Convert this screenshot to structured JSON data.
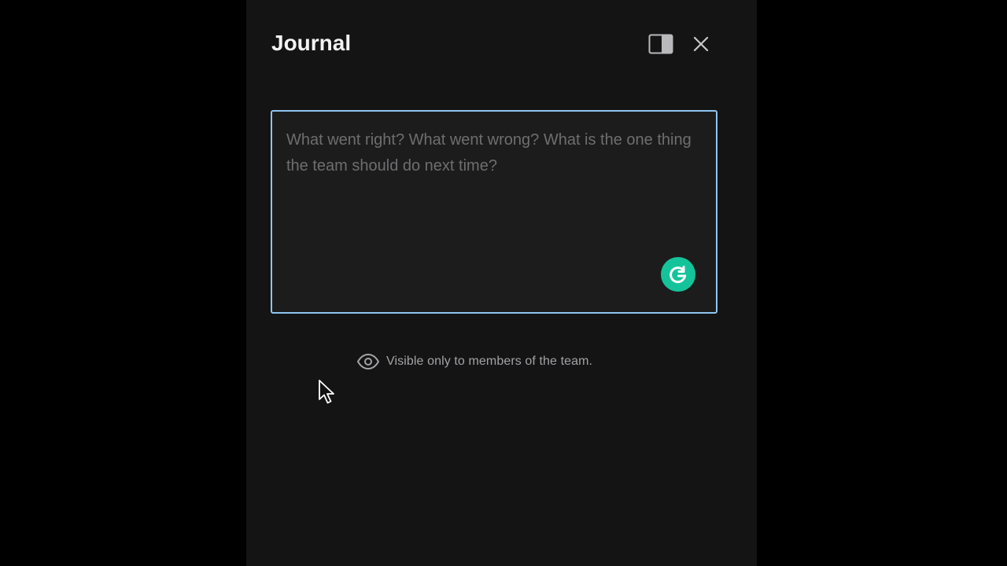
{
  "header": {
    "title": "Journal"
  },
  "icons": {
    "panel_toggle": "sidebar-panel-icon",
    "close": "close-icon",
    "grammarly": "grammarly-icon",
    "visibility": "eye-icon"
  },
  "journal": {
    "value": "",
    "placeholder": "What went right? What went wrong? What is the one thing the team should do next time?"
  },
  "visibility_note": "Visible only to members of the team.",
  "colors": {
    "background": "#000000",
    "panel": "#141415",
    "focus_border": "#8fc4f1",
    "grammarly": "#15c39a"
  }
}
